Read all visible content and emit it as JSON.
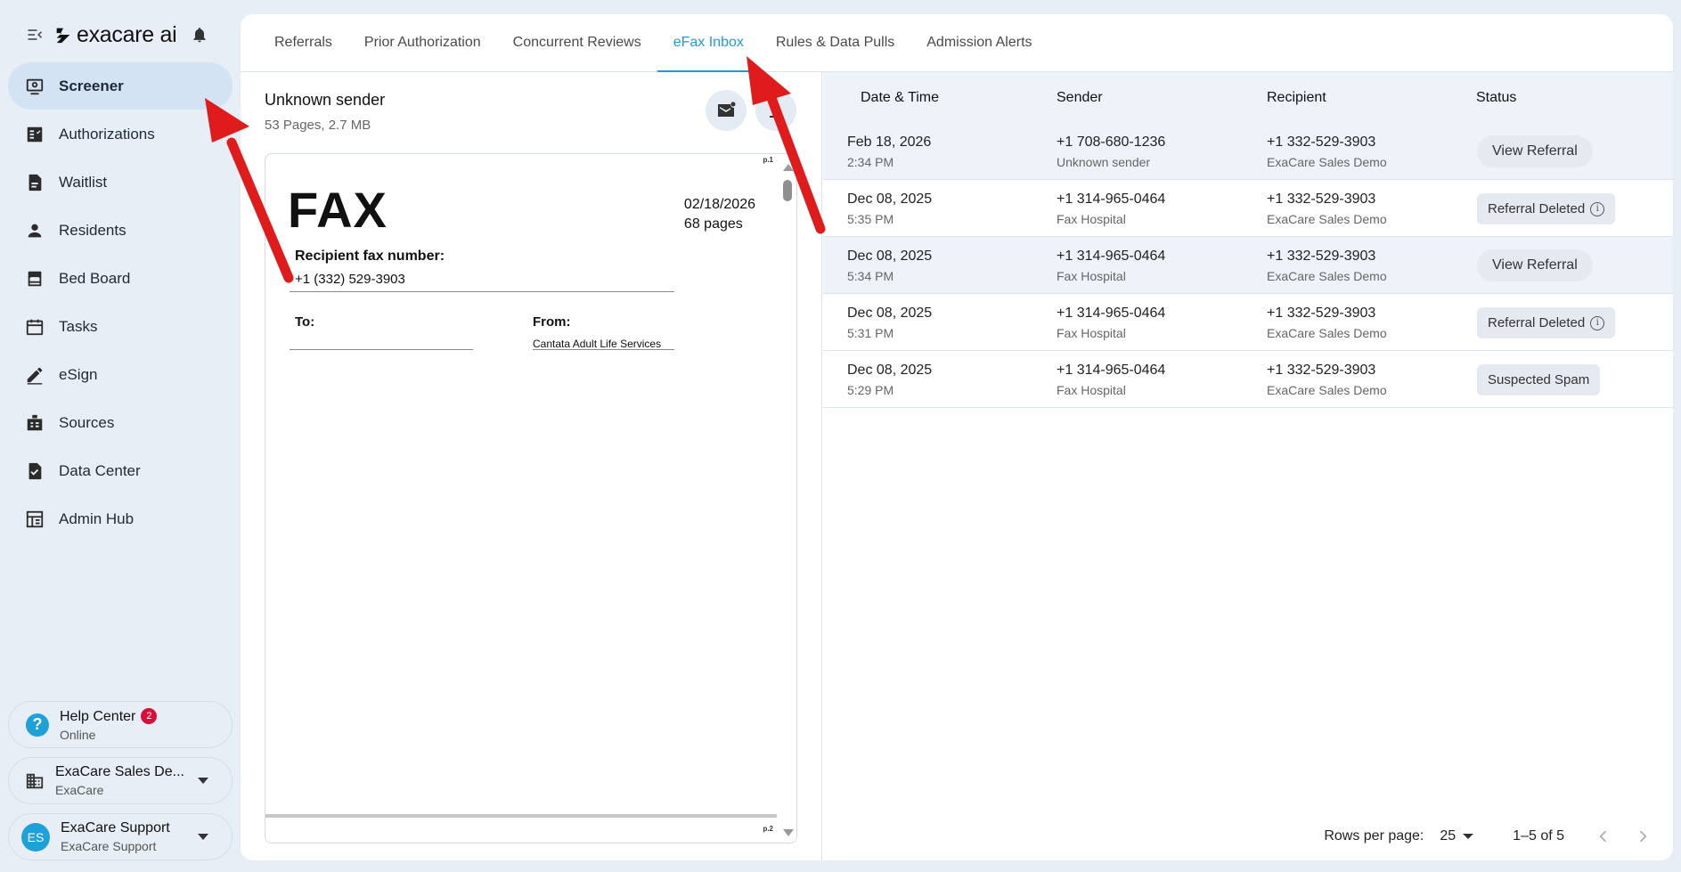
{
  "brand": {
    "name": "exacare ai",
    "menu_icon": "collapse-menu-icon",
    "bell_icon": "bell-icon"
  },
  "sidebar": {
    "items": [
      {
        "label": "Screener",
        "icon": "screener-icon",
        "active": true
      },
      {
        "label": "Authorizations",
        "icon": "authorizations-icon"
      },
      {
        "label": "Waitlist",
        "icon": "waitlist-icon"
      },
      {
        "label": "Residents",
        "icon": "person-icon"
      },
      {
        "label": "Bed Board",
        "icon": "bed-icon"
      },
      {
        "label": "Tasks",
        "icon": "calendar-icon"
      },
      {
        "label": "eSign",
        "icon": "pen-icon"
      },
      {
        "label": "Sources",
        "icon": "sources-icon"
      },
      {
        "label": "Data Center",
        "icon": "data-center-icon"
      },
      {
        "label": "Admin Hub",
        "icon": "admin-hub-icon"
      }
    ],
    "help": {
      "title": "Help Center",
      "badge": "2",
      "status": "Online"
    },
    "org": {
      "title": "ExaCare Sales De...",
      "subtitle": "ExaCare"
    },
    "user": {
      "initials": "ES",
      "title": "ExaCare Support",
      "subtitle": "ExaCare Support"
    }
  },
  "tabs": [
    "Referrals",
    "Prior Authorization",
    "Concurrent Reviews",
    "eFax Inbox",
    "Rules & Data Pulls",
    "Admission Alerts"
  ],
  "active_tab": "eFax Inbox",
  "preview": {
    "title": "Unknown sender",
    "meta": "53 Pages, 2.7 MB",
    "doc": {
      "heading": "FAX",
      "date": "02/18/2026",
      "pages": "68 pages",
      "recipient_label": "Recipient fax number:",
      "recipient_number": "+1 (332) 529-3903",
      "to_label": "To:",
      "from_label": "From:",
      "from_value": "Cantata Adult Life Services",
      "page1": "p.1",
      "page2": "p.2"
    }
  },
  "table": {
    "headers": [
      "Date & Time",
      "Sender",
      "Recipient",
      "Status"
    ],
    "rows": [
      {
        "date": "Feb 18, 2026",
        "time": "2:34 PM",
        "sender": "+1 708-680-1236",
        "sender_name": "Unknown sender",
        "recipient": "+1 332-529-3903",
        "recipient_name": "ExaCare Sales Demo",
        "status": "View Referral"
      },
      {
        "date": "Dec 08, 2025",
        "time": "5:35 PM",
        "sender": "+1 314-965-0464",
        "sender_name": "Fax Hospital",
        "recipient": "+1 332-529-3903",
        "recipient_name": "ExaCare Sales Demo",
        "status": "Referral Deleted"
      },
      {
        "date": "Dec 08, 2025",
        "time": "5:34 PM",
        "sender": "+1 314-965-0464",
        "sender_name": "Fax Hospital",
        "recipient": "+1 332-529-3903",
        "recipient_name": "ExaCare Sales Demo",
        "status": "View Referral"
      },
      {
        "date": "Dec 08, 2025",
        "time": "5:31 PM",
        "sender": "+1 314-965-0464",
        "sender_name": "Fax Hospital",
        "recipient": "+1 332-529-3903",
        "recipient_name": "ExaCare Sales Demo",
        "status": "Referral Deleted"
      },
      {
        "date": "Dec 08, 2025",
        "time": "5:29 PM",
        "sender": "+1 314-965-0464",
        "sender_name": "Fax Hospital",
        "recipient": "+1 332-529-3903",
        "recipient_name": "ExaCare Sales Demo",
        "status": "Suspected Spam"
      }
    ],
    "footer": {
      "rows_per_page_label": "Rows per page:",
      "rows_per_page": "25",
      "range": "1–5 of 5"
    }
  },
  "colors": {
    "accent": "#1e9ad6",
    "badge": "#d6103a",
    "arrow": "#e01b1b",
    "sidebar_active": "#d3e3f3"
  }
}
